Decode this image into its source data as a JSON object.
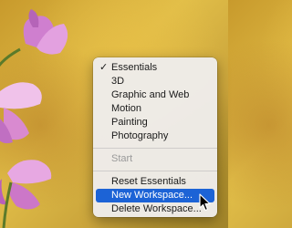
{
  "background": {
    "description_icon": "pink-flower-photo",
    "colors": {
      "yellow": "#e2bf49",
      "petal": "#d98ad0",
      "stem": "#5b7a2a"
    }
  },
  "workspace_menu": {
    "workspaces": [
      {
        "label": "Essentials",
        "checked": true
      },
      {
        "label": "3D",
        "checked": false
      },
      {
        "label": "Graphic and Web",
        "checked": false
      },
      {
        "label": "Motion",
        "checked": false
      },
      {
        "label": "Painting",
        "checked": false
      },
      {
        "label": "Photography",
        "checked": false
      }
    ],
    "check_glyph": "✓",
    "start_label": "Start",
    "reset_label": "Reset Essentials",
    "new_label": "New Workspace...",
    "delete_label": "Delete Workspace...",
    "highlight_color": "#1c63d6"
  },
  "cursor_icon": "arrow-pointer-icon"
}
